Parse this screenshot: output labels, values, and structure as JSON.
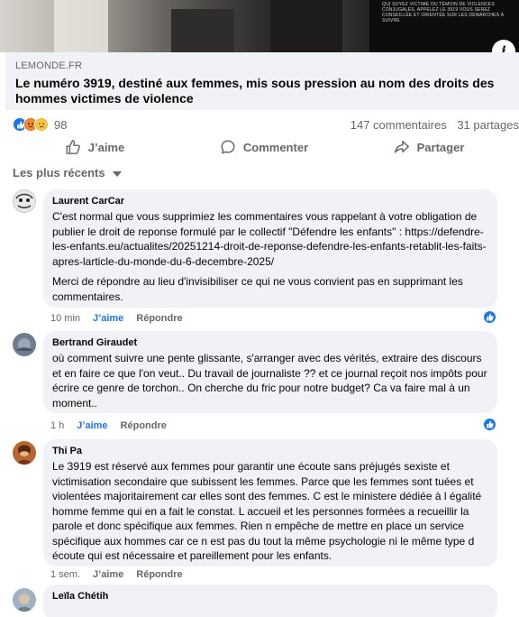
{
  "post": {
    "domain": "LEMONDE.FR",
    "headline": "Le numéro 3919, destiné aux femmes, mis sous pression au nom des droits des hommes victimes de violence",
    "image_text": "QUI SOYEZ VICTIME OU TÉMOIN DE VIOLENCES CONJUGALES, APPELEZ LE 3919 VOUS SEREZ CONSEILLÉE ET ORIENTÉE SUR LES DÉMARCHES À SUIVRE",
    "info_icon": "info-icon"
  },
  "summary": {
    "reactions": [
      "like",
      "angry",
      "sad"
    ],
    "reaction_count": "98",
    "comments": "147 commentaires",
    "shares": "31 partages"
  },
  "actions": {
    "like": "J’aime",
    "comment": "Commenter",
    "share": "Partager"
  },
  "sort_label": "Les plus récents",
  "comments": [
    {
      "author": "Laurent CarCar",
      "paragraphs": [
        "C'est normal que vous supprimiez les commentaires vous rappelant à votre obligation de publier le droit de reponse formulé par le collectif \"Défendre les enfants\" : https://defendre-les-enfants.eu/actualites/20251214-droit-de-reponse-defendre-les-enfants-retablit-les-faits-apres-larticle-du-monde-du-6-decembre-2025/",
        "Merci de répondre au lieu d'invisibiliser ce qui ne vous convient pas en supprimant les commentaires."
      ],
      "time": "10 min",
      "like": "J’aime",
      "reply": "Répondre",
      "liked": true
    },
    {
      "author": "Bertrand Giraudet",
      "paragraphs": [
        "où comment suivre une pente glissante, s'arranger avec des vérités, extraire des discours et en faire ce que l'on veut.. Du travail de journaliste ?? et ce journal reçoit nos impôts pour écrire ce genre de torchon.. On cherche du fric pour notre budget? Ca va faire mal à un moment.."
      ],
      "time": "1 h",
      "like": "J’aime",
      "reply": "Répondre",
      "liked": true
    },
    {
      "author": "Thi Pa",
      "paragraphs": [
        "Le 3919 est réservé aux femmes pour garantir une écoute sans préjugés sexiste et victimisation secondaire que subissent les femmes. Parce que les femmes sont tuées et violentées majoritairement car elles sont des femmes. C est le ministere dédiée à l égalité homme femme qui en a fait le constat. L accueil et les personnes formées a recueillir la parole et donc spécifique aux femmes. Rien n empêche de mettre en place un service spécifique aux hommes car ce n est pas du tout la même psychologie ni le même type d écoute qui est nécessaire et pareillement pour les enfants."
      ],
      "time": "1 sem.",
      "like": "J’aime",
      "reply": "Répondre",
      "liked": false
    },
    {
      "author": "Leïla Chétih",
      "paragraphs": [],
      "time": "",
      "like": "",
      "reply": "",
      "liked": false
    }
  ]
}
